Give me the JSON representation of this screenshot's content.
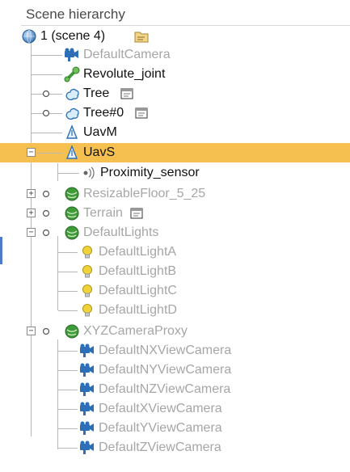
{
  "panel": {
    "title": "Scene hierarchy"
  },
  "tree": {
    "root_label": "1 (scene 4)",
    "nodes": [
      {
        "label": "DefaultCamera",
        "icon": "camera-icon",
        "active": false
      },
      {
        "label": "Revolute_joint",
        "icon": "joint-icon",
        "active": true
      },
      {
        "label": "Tree",
        "icon": "shape-icon",
        "active": true,
        "visibility_dot": true,
        "extra": "script-icon"
      },
      {
        "label": "Tree#0",
        "icon": "shape-icon",
        "active": true,
        "visibility_dot": true,
        "extra": "script-icon"
      },
      {
        "label": "UavM",
        "icon": "uav-icon",
        "active": true
      },
      {
        "label": "UavS",
        "icon": "uav-icon",
        "active": true,
        "selected": true,
        "expander": "minus"
      },
      {
        "label": "Proximity_sensor",
        "icon": "proximity-sensor-icon",
        "active": true
      },
      {
        "label": "ResizableFloor_5_25",
        "icon": "model-icon",
        "active": false,
        "visibility_dot": true,
        "expander": "plus"
      },
      {
        "label": "Terrain",
        "icon": "model-icon",
        "active": false,
        "visibility_dot": true,
        "expander": "plus",
        "extra": "script-icon"
      },
      {
        "label": "DefaultLights",
        "icon": "model-icon",
        "active": false,
        "visibility_dot": true,
        "expander": "minus"
      },
      {
        "label": "DefaultLightA",
        "icon": "light-icon",
        "active": false
      },
      {
        "label": "DefaultLightB",
        "icon": "light-icon",
        "active": false
      },
      {
        "label": "DefaultLightC",
        "icon": "light-icon",
        "active": false
      },
      {
        "label": "DefaultLightD",
        "icon": "light-icon",
        "active": false
      },
      {
        "label": "XYZCameraProxy",
        "icon": "model-icon",
        "active": false,
        "visibility_dot": true,
        "expander": "minus"
      },
      {
        "label": "DefaultNXViewCamera",
        "icon": "camera-icon",
        "active": false
      },
      {
        "label": "DefaultNYViewCamera",
        "icon": "camera-icon",
        "active": false
      },
      {
        "label": "DefaultNZViewCamera",
        "icon": "camera-icon",
        "active": false
      },
      {
        "label": "DefaultXViewCamera",
        "icon": "camera-icon",
        "active": false
      },
      {
        "label": "DefaultYViewCamera",
        "icon": "camera-icon",
        "active": false
      },
      {
        "label": "DefaultZViewCamera",
        "icon": "camera-icon",
        "active": false
      }
    ]
  },
  "colors": {
    "selection": "#f6c050",
    "active_text": "#111111",
    "inactive_text": "#a6a6a6",
    "camera": "#2d6fb7",
    "light": "#e2c21a",
    "model": "#3f9a3a"
  }
}
